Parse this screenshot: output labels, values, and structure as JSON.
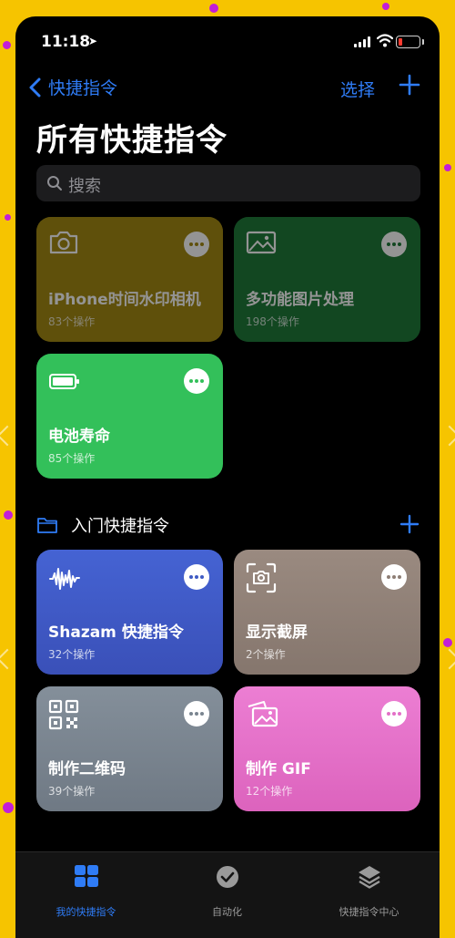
{
  "status": {
    "time": "11:18",
    "location_glyph": "➤"
  },
  "nav": {
    "back_label": "快捷指令",
    "select_label": "选择"
  },
  "page": {
    "title": "所有快捷指令"
  },
  "search": {
    "placeholder": "搜索"
  },
  "shortcuts": [
    {
      "name": "iPhone时间水印相机",
      "count": "83个操作",
      "color": "#a48b14",
      "icon": "camera-icon"
    },
    {
      "name": "多功能图片处理",
      "count": "198个操作",
      "color": "#1f7a3a",
      "icon": "photo-icon"
    },
    {
      "name": "电池寿命",
      "count": "85个操作",
      "color": "#33c05a",
      "icon": "battery-icon"
    }
  ],
  "section": {
    "title": "入门快捷指令"
  },
  "starter_shortcuts": [
    {
      "name": "Shazam 快捷指令",
      "count": "32个操作",
      "color": "#3f5bc4",
      "icon": "soundwave-icon"
    },
    {
      "name": "显示截屏",
      "count": "2个操作",
      "color": "#8e7e75",
      "icon": "screenshot-icon"
    },
    {
      "name": "制作二维码",
      "count": "39个操作",
      "color": "#7a8590",
      "icon": "qrcode-icon"
    },
    {
      "name": "制作 GIF",
      "count": "12个操作",
      "color": "#e36fc7",
      "icon": "photos-stack-icon"
    }
  ],
  "tabbar": {
    "tabs": [
      {
        "label": "我的快捷指令",
        "active": true
      },
      {
        "label": "自动化",
        "active": false
      },
      {
        "label": "快捷指令中心",
        "active": false
      }
    ]
  },
  "colors": {
    "accent": "#2f7cf6",
    "background": "#000000",
    "frame": "#f6c400"
  }
}
